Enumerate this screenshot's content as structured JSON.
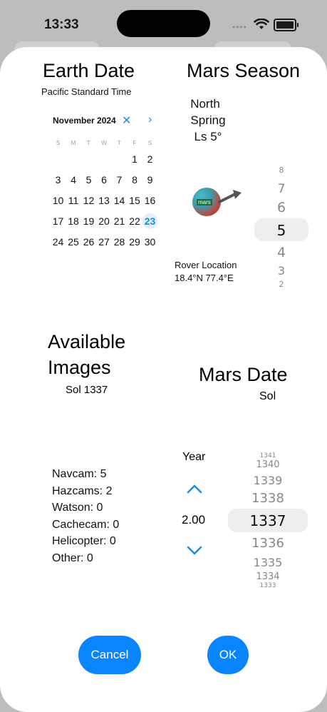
{
  "status": {
    "time": "13:33"
  },
  "earth": {
    "title": "Earth Date",
    "timezone": "Pacific Standard Time",
    "month_label": "November 2024",
    "weekdays": [
      "S",
      "M",
      "T",
      "W",
      "T",
      "F",
      "S"
    ],
    "weeks": [
      [
        "",
        "",
        "",
        "",
        "",
        "1",
        "2"
      ],
      [
        "3",
        "4",
        "5",
        "6",
        "7",
        "8",
        "9"
      ],
      [
        "10",
        "11",
        "12",
        "13",
        "14",
        "15",
        "16"
      ],
      [
        "17",
        "18",
        "19",
        "20",
        "21",
        "22",
        "23"
      ],
      [
        "24",
        "25",
        "26",
        "27",
        "28",
        "29",
        "30"
      ]
    ],
    "selected_day": "23"
  },
  "season": {
    "title": "Mars Season",
    "hemisphere": "North",
    "season": "Spring",
    "ls_label": "Ls 5°",
    "planet_label": "mars",
    "picker": [
      "8",
      "7",
      "6",
      "5",
      "4",
      "3",
      "2"
    ],
    "picker_selected": "5",
    "rover_label": "Rover Location",
    "rover_coords": "18.4°N 77.4°E"
  },
  "images": {
    "title_line1": "Available",
    "title_line2": "Images",
    "sol_label": "Sol 1337",
    "counts": [
      "Navcam: 5",
      "Hazcams: 2",
      "Watson: 0",
      "Cachecam: 0",
      "Helicopter: 0",
      "Other: 0"
    ]
  },
  "marsdate": {
    "title": "Mars Date",
    "sol_heading": "Sol",
    "year_label": "Year",
    "year_value": "2.00",
    "picker": [
      "1341",
      "1340",
      "1339",
      "1338",
      "1337",
      "1336",
      "1335",
      "1334",
      "1333"
    ],
    "picker_selected": "1337"
  },
  "actions": {
    "cancel": "Cancel",
    "ok": "OK"
  },
  "colors": {
    "accent": "#0a84ff",
    "link": "#1a8fe3"
  }
}
